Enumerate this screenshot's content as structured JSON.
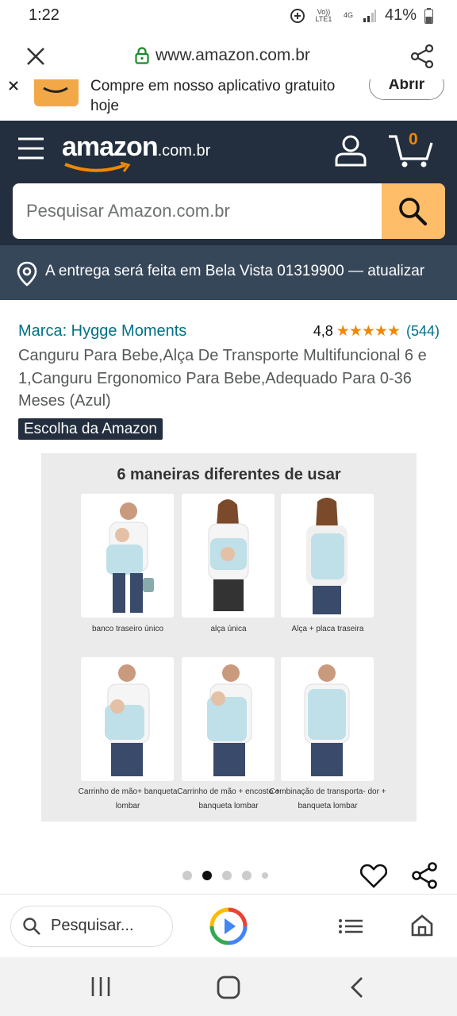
{
  "status_bar": {
    "time": "1:22",
    "network_label_top": "Vo)) LTE1",
    "network_4g": "4G",
    "battery": "41%"
  },
  "browser": {
    "url": "www.amazon.com.br"
  },
  "app_banner": {
    "text": "Compre em nosso aplicativo gratuito hoje",
    "open_label": "Abrir"
  },
  "header": {
    "logo_text": "amazon",
    "logo_suffix": ".com.br",
    "cart_count": "0"
  },
  "search": {
    "placeholder": "Pesquisar Amazon.com.br"
  },
  "delivery": {
    "text": "A entrega será feita em Bela Vista 01319900 — atualizar"
  },
  "product": {
    "brand": "Marca: Hygge Moments",
    "rating": "4,8",
    "stars": "★★★★★",
    "rating_count": "(544)",
    "title": "Canguru Para Bebe,Alça De Transporte Multifuncional 6 e 1,Canguru Ergonomico Para Bebe,Adequado Para 0-36 Meses (Azul)",
    "badge": "Escolha da Amazon"
  },
  "product_image": {
    "headline": "6 maneiras diferentes de usar",
    "captions": [
      "banco traseiro único",
      "alça única",
      "Alça + placa traseira",
      "Carrinho de mão+ banqueta lombar",
      "Carrinho de mão + encosto + banqueta lombar",
      "Combinação de transporta- dor + banqueta lombar"
    ]
  },
  "carousel": {
    "total": 5,
    "active": 2
  },
  "bottom_toolbar": {
    "search_label": "Pesquisar..."
  },
  "icons": {
    "close": "close-icon",
    "lock": "lock-icon",
    "share": "share-icon",
    "menu": "hamburger-icon",
    "account": "account-icon",
    "cart": "cart-icon",
    "search": "search-icon",
    "location": "location-pin-icon",
    "heart": "heart-icon",
    "tabs": "list-icon",
    "home": "home-icon"
  },
  "colors": {
    "header": "#232F3E",
    "delivery": "#37475A",
    "search_button": "#FEBD69",
    "link": "#007185",
    "star": "#F08804",
    "cart_count": "#F08804"
  }
}
